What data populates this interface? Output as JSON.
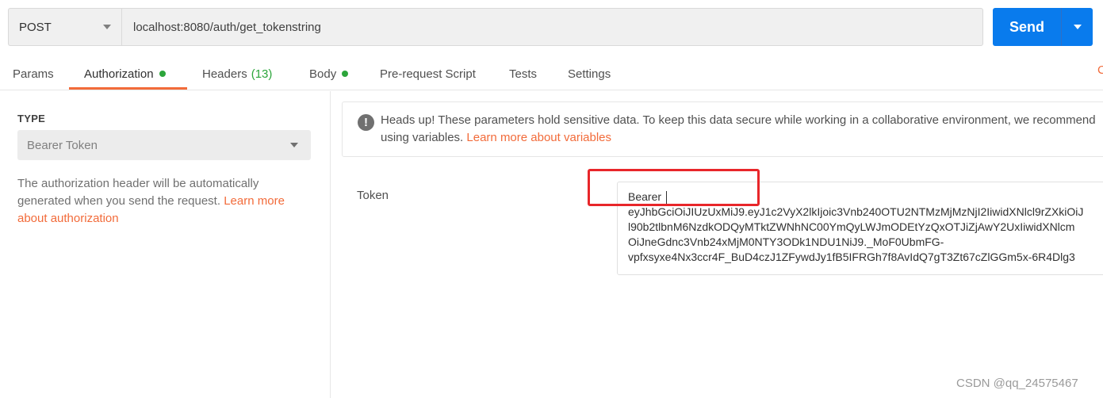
{
  "request": {
    "method": "POST",
    "url": "localhost:8080/auth/get_tokenstring",
    "send_label": "Send"
  },
  "tabs": [
    {
      "label": "Params"
    },
    {
      "label": "Authorization"
    },
    {
      "label": "Headers",
      "count": "(13)"
    },
    {
      "label": "Body"
    },
    {
      "label": "Pre-request Script"
    },
    {
      "label": "Tests"
    },
    {
      "label": "Settings"
    }
  ],
  "tab_overflow": "C",
  "auth": {
    "type_label": "TYPE",
    "type_value": "Bearer Token",
    "description": "The authorization header will be automatically generated when you send the request.",
    "learn_more": "Learn more about authorization"
  },
  "notice": {
    "text": "Heads up! These parameters hold sensitive data. To keep this data secure while working in a collaborative environment, we recommend",
    "text_line2": "using variables.",
    "link": "Learn more about variables"
  },
  "token": {
    "label": "Token",
    "lines": [
      "Bearer",
      "eyJhbGciOiJIUzUxMiJ9.eyJ1c2VyX2lkIjoic3Vnb240OTU2NTMzMjMzNjI2IiwidXNlcl9rZXkiOiJ",
      "l90b2tlbnM6NzdkODQyMTktZWNhNC00YmQyLWJmODEtYzQxOTJiZjAwY2UxIiwidXNlcm",
      "OiJneGdnc3Vnb24xMjM0NTY3ODk1NDU1NiJ9._MoF0UbmFG-",
      "vpfxsyxe4Nx3ccr4F_BuD4czJ1ZFywdJy1fB5IFRGh7f8AvIdQ7gT3Zt67cZlGGm5x-6R4Dlg3"
    ]
  },
  "watermark": "CSDN @qq_24575467",
  "colors": {
    "accent": "#f26b3a",
    "send": "#097bed",
    "status_green": "#2ca53b",
    "highlight": "#e8262a"
  }
}
